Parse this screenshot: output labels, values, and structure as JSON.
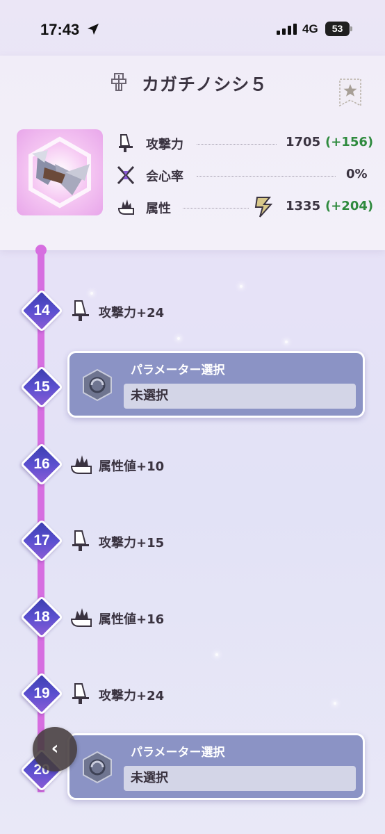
{
  "status_bar": {
    "time": "17:43",
    "network": "4G",
    "battery": "53"
  },
  "header": {
    "title": "カガチノシシ５",
    "stats": [
      {
        "label": "攻撃力",
        "value": "1705",
        "bonus": "(+156)",
        "icon": "attack-sword-icon"
      },
      {
        "label": "会心率",
        "value": "0%",
        "bonus": "",
        "icon": "affinity-icon"
      },
      {
        "label": "属性",
        "value": "1335",
        "bonus": "(+204)",
        "icon": "element-fire-icon",
        "element_icon": "thunder-element-icon"
      }
    ]
  },
  "timeline": {
    "nodes": [
      {
        "level": "14",
        "type": "bonus",
        "text": "攻撃力+24",
        "icon": "attack-sword-icon"
      },
      {
        "level": "15",
        "type": "select",
        "title": "パラメーター選択",
        "value": "未選択"
      },
      {
        "level": "16",
        "type": "bonus",
        "text": "属性値+10",
        "icon": "element-fire-icon"
      },
      {
        "level": "17",
        "type": "bonus",
        "text": "攻撃力+15",
        "icon": "attack-sword-icon"
      },
      {
        "level": "18",
        "type": "bonus",
        "text": "属性値+16",
        "icon": "element-fire-icon"
      },
      {
        "level": "19",
        "type": "bonus",
        "text": "攻撃力+24",
        "icon": "attack-sword-icon"
      },
      {
        "level": "20",
        "type": "select",
        "title": "パラメーター選択",
        "value": "未選択"
      }
    ]
  },
  "back_button": {
    "label": "‹"
  },
  "colors": {
    "accent": "#d66ee0",
    "node": "#4a46c0",
    "card": "#8b93c5",
    "bonus_green": "#2f8a3e"
  }
}
